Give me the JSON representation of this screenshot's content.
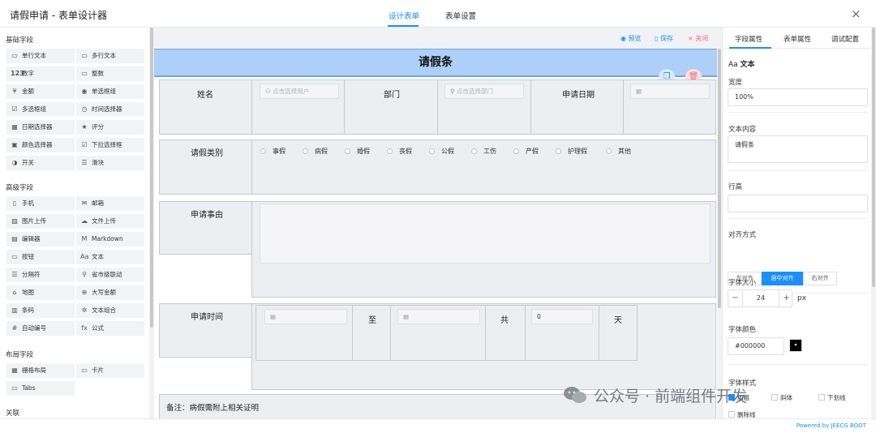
{
  "window": {
    "title": "请假申请 - 表单设计器",
    "close_icon": "×"
  },
  "tabs": [
    {
      "label": "设计表单",
      "active": true
    },
    {
      "label": "表单设置",
      "active": false
    }
  ],
  "sidebar": {
    "sections": [
      {
        "title": "基础字段",
        "items": [
          {
            "label": "单行文本",
            "icon": "▭"
          },
          {
            "label": "多行文本",
            "icon": "▭"
          },
          {
            "label": "数字",
            "icon": "123"
          },
          {
            "label": "整数",
            "icon": "▭"
          },
          {
            "label": "金额",
            "icon": "¥"
          },
          {
            "label": "单选框组",
            "icon": "◉"
          },
          {
            "label": "多选框组",
            "icon": "☑"
          },
          {
            "label": "时间选择器",
            "icon": "◷"
          },
          {
            "label": "日期选择器",
            "icon": "▦"
          },
          {
            "label": "评分",
            "icon": "★"
          },
          {
            "label": "颜色选择器",
            "icon": "▣"
          },
          {
            "label": "下拉选择框",
            "icon": "☑"
          },
          {
            "label": "开关",
            "icon": "◑"
          },
          {
            "label": "滑块",
            "icon": "☰"
          }
        ]
      },
      {
        "title": "高级字段",
        "items": [
          {
            "label": "手机",
            "icon": "▯"
          },
          {
            "label": "邮箱",
            "icon": "✉"
          },
          {
            "label": "图片上传",
            "icon": "▨"
          },
          {
            "label": "文件上传",
            "icon": "☁"
          },
          {
            "label": "编辑器",
            "icon": "▤"
          },
          {
            "label": "Markdown",
            "icon": "M"
          },
          {
            "label": "按钮",
            "icon": "▭"
          },
          {
            "label": "文本",
            "icon": "Aa"
          },
          {
            "label": "分隔符",
            "icon": "☰"
          },
          {
            "label": "省市级联动",
            "icon": "⚲"
          },
          {
            "label": "地图",
            "icon": "⌂"
          },
          {
            "label": "大写金额",
            "icon": "⊕"
          },
          {
            "label": "条码",
            "icon": "▥"
          },
          {
            "label": "文本组合",
            "icon": "✲"
          },
          {
            "label": "自动编号",
            "icon": "#"
          },
          {
            "label": "公式",
            "icon": "fx"
          }
        ]
      },
      {
        "title": "布局字段",
        "items": [
          {
            "label": "栅格布局",
            "icon": "▦"
          },
          {
            "label": "卡片",
            "icon": "▭"
          },
          {
            "label": "Tabs",
            "icon": "▭"
          }
        ]
      },
      {
        "title": "关联",
        "items": []
      }
    ]
  },
  "canvas_actions": {
    "preview": "预览",
    "save": "保存",
    "close": "关闭"
  },
  "form": {
    "title": "请假条",
    "row1": {
      "name_label": "姓名",
      "name_placeholder": "点击选择用户",
      "dept_label": "部门",
      "dept_placeholder": "点击选择部门",
      "date_label": "申请日期"
    },
    "type_label": "请假类别",
    "leave_types": [
      "事假",
      "病假",
      "婚假",
      "丧假",
      "公假",
      "工伤",
      "产假",
      "护理假",
      "其他"
    ],
    "reason_label": "申请事由",
    "time_label": "申请时间",
    "to_label": "至",
    "total_label": "共",
    "total_value": "0",
    "day_unit": "天",
    "remark": "备注：病假需附上相关证明"
  },
  "properties": {
    "tabs": [
      "字段属性",
      "表单属性",
      "调试配置"
    ],
    "field_type": "文本",
    "width_label": "宽度",
    "width_value": "100%",
    "content_label": "文本内容",
    "content_value": "请假条",
    "line_height_label": "行高",
    "align_label": "对齐方式",
    "align_options": [
      "左对齐",
      "居中对齐",
      "右对齐"
    ],
    "align_selected": "居中对齐",
    "font_size_label": "字体大小",
    "font_size_value": "24",
    "font_size_unit": "px",
    "font_color_label": "字体颜色",
    "font_color_value": "#000000",
    "font_style_label": "字体样式",
    "font_styles": [
      "加粗",
      "斜体",
      "下划线",
      "删除线"
    ]
  },
  "footer": {
    "powered": "Powered by JEECG BOOT"
  },
  "watermark": "公众号 · 前端组件开发",
  "colors": {
    "accent": "#1890ff",
    "title_bar": "#aecff6",
    "danger": "#f56c6c"
  }
}
